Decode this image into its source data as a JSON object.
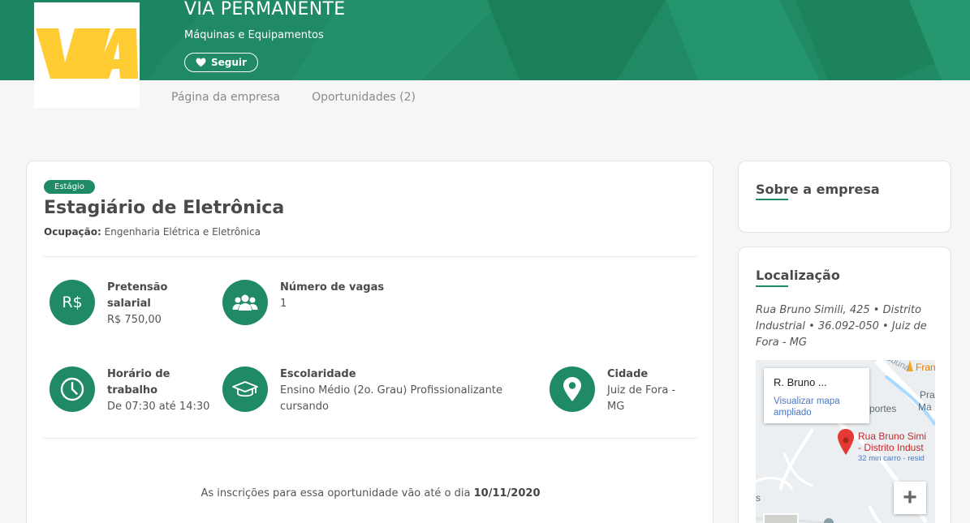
{
  "company": {
    "name": "VIA PERMANENTE",
    "sector": "Máquinas e Equipamentos",
    "follow_label": "Seguir",
    "logo_text": "VIA",
    "brand_color": "#1f8a63",
    "logo_color": "#ffcc33"
  },
  "tabs": [
    {
      "label": "Página da empresa"
    },
    {
      "label": "Oportunidades (2)"
    }
  ],
  "job": {
    "badge": "Estágio",
    "title": "Estagiário de Eletrônica",
    "occupation_label": "Ocupação:",
    "occupation_value": "Engenharia Elétrica e Eletrônica",
    "salary": {
      "icon_text": "R$",
      "label": "Pretensão salarial",
      "value": "R$ 750,00"
    },
    "openings": {
      "icon": "users-icon",
      "label": "Número de vagas",
      "value": "1"
    },
    "schedule": {
      "icon": "clock-icon",
      "label": "Horário de trabalho",
      "value": "De 07:30 até 14:30"
    },
    "education": {
      "icon": "graduation-cap-icon",
      "label": "Escolaridade",
      "value": "Ensino Médio (2o. Grau) Profissionalizante cursando"
    },
    "city": {
      "icon": "map-pin-icon",
      "label": "Cidade",
      "value": "Juiz de Fora - MG"
    },
    "deadline_text": "As inscrições para essa oportunidade vão até o dia",
    "deadline_date": "10/11/2020"
  },
  "sidebar": {
    "about_title": "Sobre a empresa",
    "location_title": "Localização",
    "address": "Rua Bruno Simili, 425 • Distrito Industrial • 36.092-050 • Juiz de Fora - MG",
    "map": {
      "info_title": "R. Bruno ...",
      "info_link": "Visualizar mapa ampliado",
      "pin_label_1": "Rua Bruno Simi",
      "pin_label_2": "- Distrito Indust",
      "pin_label_3": "32 min carro - resid",
      "road_label": "ubuna",
      "poi_label": "Fran",
      "area_label_1": "Pra",
      "area_label_2": "Ma",
      "street_label": "portes",
      "edge_label": "s",
      "zoom_in": "+"
    }
  }
}
